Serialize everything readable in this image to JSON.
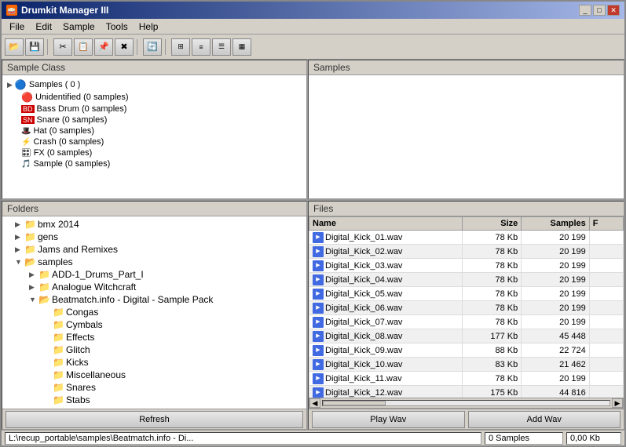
{
  "window": {
    "title": "Drumkit Manager III",
    "title_icon": "🥁"
  },
  "menu": {
    "items": [
      "File",
      "Edit",
      "Sample",
      "Tools",
      "Help"
    ]
  },
  "toolbar": {
    "buttons": [
      {
        "icon": "📂",
        "name": "open"
      },
      {
        "icon": "💾",
        "name": "save"
      },
      {
        "icon": "✂",
        "name": "cut"
      },
      {
        "icon": "📋",
        "name": "copy"
      },
      {
        "icon": "📌",
        "name": "paste"
      },
      {
        "icon": "✖",
        "name": "delete"
      },
      {
        "icon": "🔄",
        "name": "refresh"
      },
      {
        "icon": "▦",
        "name": "view1"
      },
      {
        "icon": "☰",
        "name": "view2"
      },
      {
        "icon": "▤",
        "name": "view3"
      },
      {
        "icon": "▧",
        "name": "view4"
      }
    ]
  },
  "sample_class": {
    "title": "Sample Class",
    "root_label": "Samples ( 0 )",
    "items": [
      {
        "label": "Unidentified (0 samples)",
        "icon": "🔴"
      },
      {
        "label": "Bass Drum (0 samples)",
        "icon": "🥁"
      },
      {
        "label": "Snare (0 samples)",
        "icon": "🥁"
      },
      {
        "label": "Hat (0 samples)",
        "icon": "🎩"
      },
      {
        "label": "Crash (0 samples)",
        "icon": "💥"
      },
      {
        "label": "FX (0 samples)",
        "icon": "🎛"
      },
      {
        "label": "Sample (0 samples)",
        "icon": "🎵"
      }
    ]
  },
  "samples": {
    "title": "Samples"
  },
  "folders": {
    "title": "Folders",
    "items": [
      {
        "label": "bmx 2014",
        "indent": 1,
        "expanded": false
      },
      {
        "label": "gens",
        "indent": 1,
        "expanded": false
      },
      {
        "label": "Jams and Remixes",
        "indent": 1,
        "expanded": false
      },
      {
        "label": "samples",
        "indent": 1,
        "expanded": true
      },
      {
        "label": "ADD-1_Drums_Part_I",
        "indent": 2,
        "expanded": false
      },
      {
        "label": "Analogue Witchcraft",
        "indent": 2,
        "expanded": false
      },
      {
        "label": "Beatmatch.info - Digital - Sample Pack",
        "indent": 2,
        "expanded": true
      },
      {
        "label": "Congas",
        "indent": 3,
        "expanded": false
      },
      {
        "label": "Cymbals",
        "indent": 3,
        "expanded": false
      },
      {
        "label": "Effects",
        "indent": 3,
        "expanded": false
      },
      {
        "label": "Glitch",
        "indent": 3,
        "expanded": false
      },
      {
        "label": "Kicks",
        "indent": 3,
        "expanded": false
      },
      {
        "label": "Miscellaneous",
        "indent": 3,
        "expanded": false
      },
      {
        "label": "Snares",
        "indent": 3,
        "expanded": false
      },
      {
        "label": "Stabs",
        "indent": 3,
        "expanded": false
      }
    ],
    "refresh_label": "Refresh"
  },
  "files": {
    "title": "Files",
    "columns": [
      "Name",
      "Size",
      "Samples",
      "F"
    ],
    "rows": [
      {
        "name": "Digital_Kick_01.wav",
        "size": "78 Kb",
        "samples": "20 199",
        "f": ""
      },
      {
        "name": "Digital_Kick_02.wav",
        "size": "78 Kb",
        "samples": "20 199",
        "f": ""
      },
      {
        "name": "Digital_Kick_03.wav",
        "size": "78 Kb",
        "samples": "20 199",
        "f": ""
      },
      {
        "name": "Digital_Kick_04.wav",
        "size": "78 Kb",
        "samples": "20 199",
        "f": ""
      },
      {
        "name": "Digital_Kick_05.wav",
        "size": "78 Kb",
        "samples": "20 199",
        "f": ""
      },
      {
        "name": "Digital_Kick_06.wav",
        "size": "78 Kb",
        "samples": "20 199",
        "f": ""
      },
      {
        "name": "Digital_Kick_07.wav",
        "size": "78 Kb",
        "samples": "20 199",
        "f": ""
      },
      {
        "name": "Digital_Kick_08.wav",
        "size": "177 Kb",
        "samples": "45 448",
        "f": ""
      },
      {
        "name": "Digital_Kick_09.wav",
        "size": "88 Kb",
        "samples": "22 724",
        "f": ""
      },
      {
        "name": "Digital_Kick_10.wav",
        "size": "83 Kb",
        "samples": "21 462",
        "f": ""
      },
      {
        "name": "Digital_Kick_11.wav",
        "size": "78 Kb",
        "samples": "20 199",
        "f": ""
      },
      {
        "name": "Digital_Kick_12.wav",
        "size": "175 Kb",
        "samples": "44 816",
        "f": ""
      }
    ],
    "play_wav_label": "Play Wav",
    "add_wav_label": "Add Wav"
  },
  "status": {
    "path": "L:\\recup_portable\\samples\\Beatmatch.info - Di...",
    "samples": "0 Samples",
    "size": "0,00 Kb"
  },
  "colors": {
    "accent": "#0a246a",
    "toolbar_bg": "#d4d0c8",
    "panel_bg": "#ffffff",
    "folder_yellow": "#ffd700"
  }
}
